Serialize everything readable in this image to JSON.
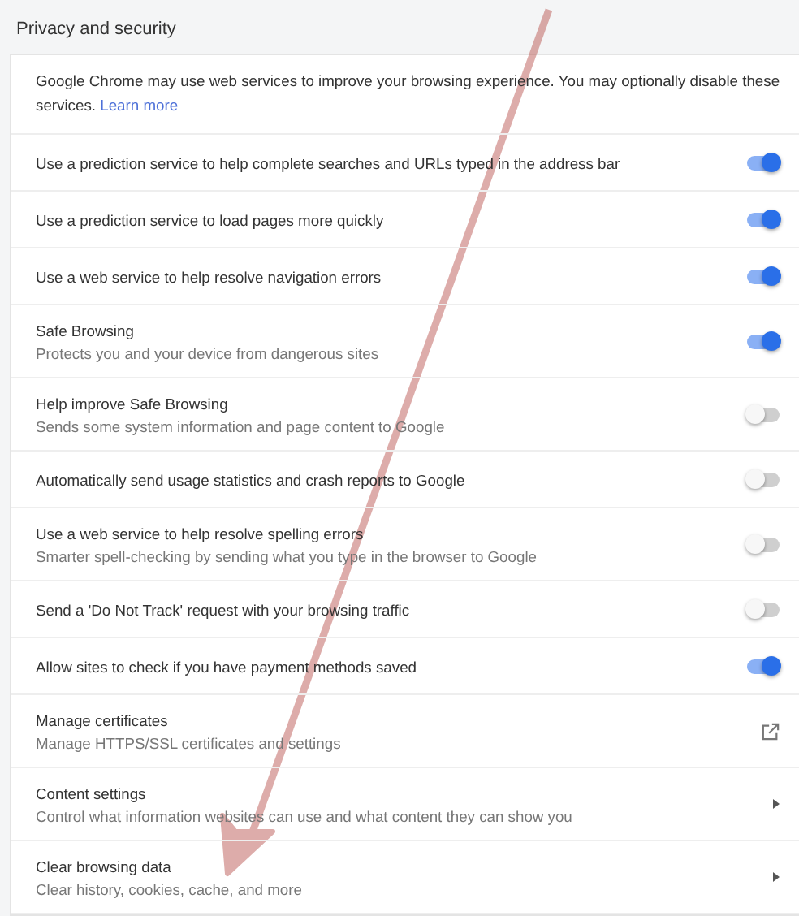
{
  "section_title": "Privacy and security",
  "intro": {
    "text": "Google Chrome may use web services to improve your browsing experience. You may optionally disable these services.",
    "link": "Learn more"
  },
  "rows": [
    {
      "kind": "toggle",
      "label": "Use a prediction service to help complete searches and URLs typed in the address bar",
      "on": true
    },
    {
      "kind": "toggle",
      "label": "Use a prediction service to load pages more quickly",
      "on": true
    },
    {
      "kind": "toggle",
      "label": "Use a web service to help resolve navigation errors",
      "on": true
    },
    {
      "kind": "toggle",
      "label": "Safe Browsing",
      "sublabel": "Protects you and your device from dangerous sites",
      "on": true
    },
    {
      "kind": "toggle",
      "label": "Help improve Safe Browsing",
      "sublabel": "Sends some system information and page content to Google",
      "on": false
    },
    {
      "kind": "toggle",
      "label": "Automatically send usage statistics and crash reports to Google",
      "on": false
    },
    {
      "kind": "toggle",
      "label": "Use a web service to help resolve spelling errors",
      "sublabel": "Smarter spell-checking by sending what you type in the browser to Google",
      "on": false
    },
    {
      "kind": "toggle",
      "label": "Send a 'Do Not Track' request with your browsing traffic",
      "on": false
    },
    {
      "kind": "toggle",
      "label": "Allow sites to check if you have payment methods saved",
      "on": true
    },
    {
      "kind": "external",
      "label": "Manage certificates",
      "sublabel": "Manage HTTPS/SSL certificates and settings"
    },
    {
      "kind": "submenu",
      "label": "Content settings",
      "sublabel": "Control what information websites can use and what content they can show you"
    },
    {
      "kind": "submenu",
      "label": "Clear browsing data",
      "sublabel": "Clear history, cookies, cache, and more"
    }
  ]
}
